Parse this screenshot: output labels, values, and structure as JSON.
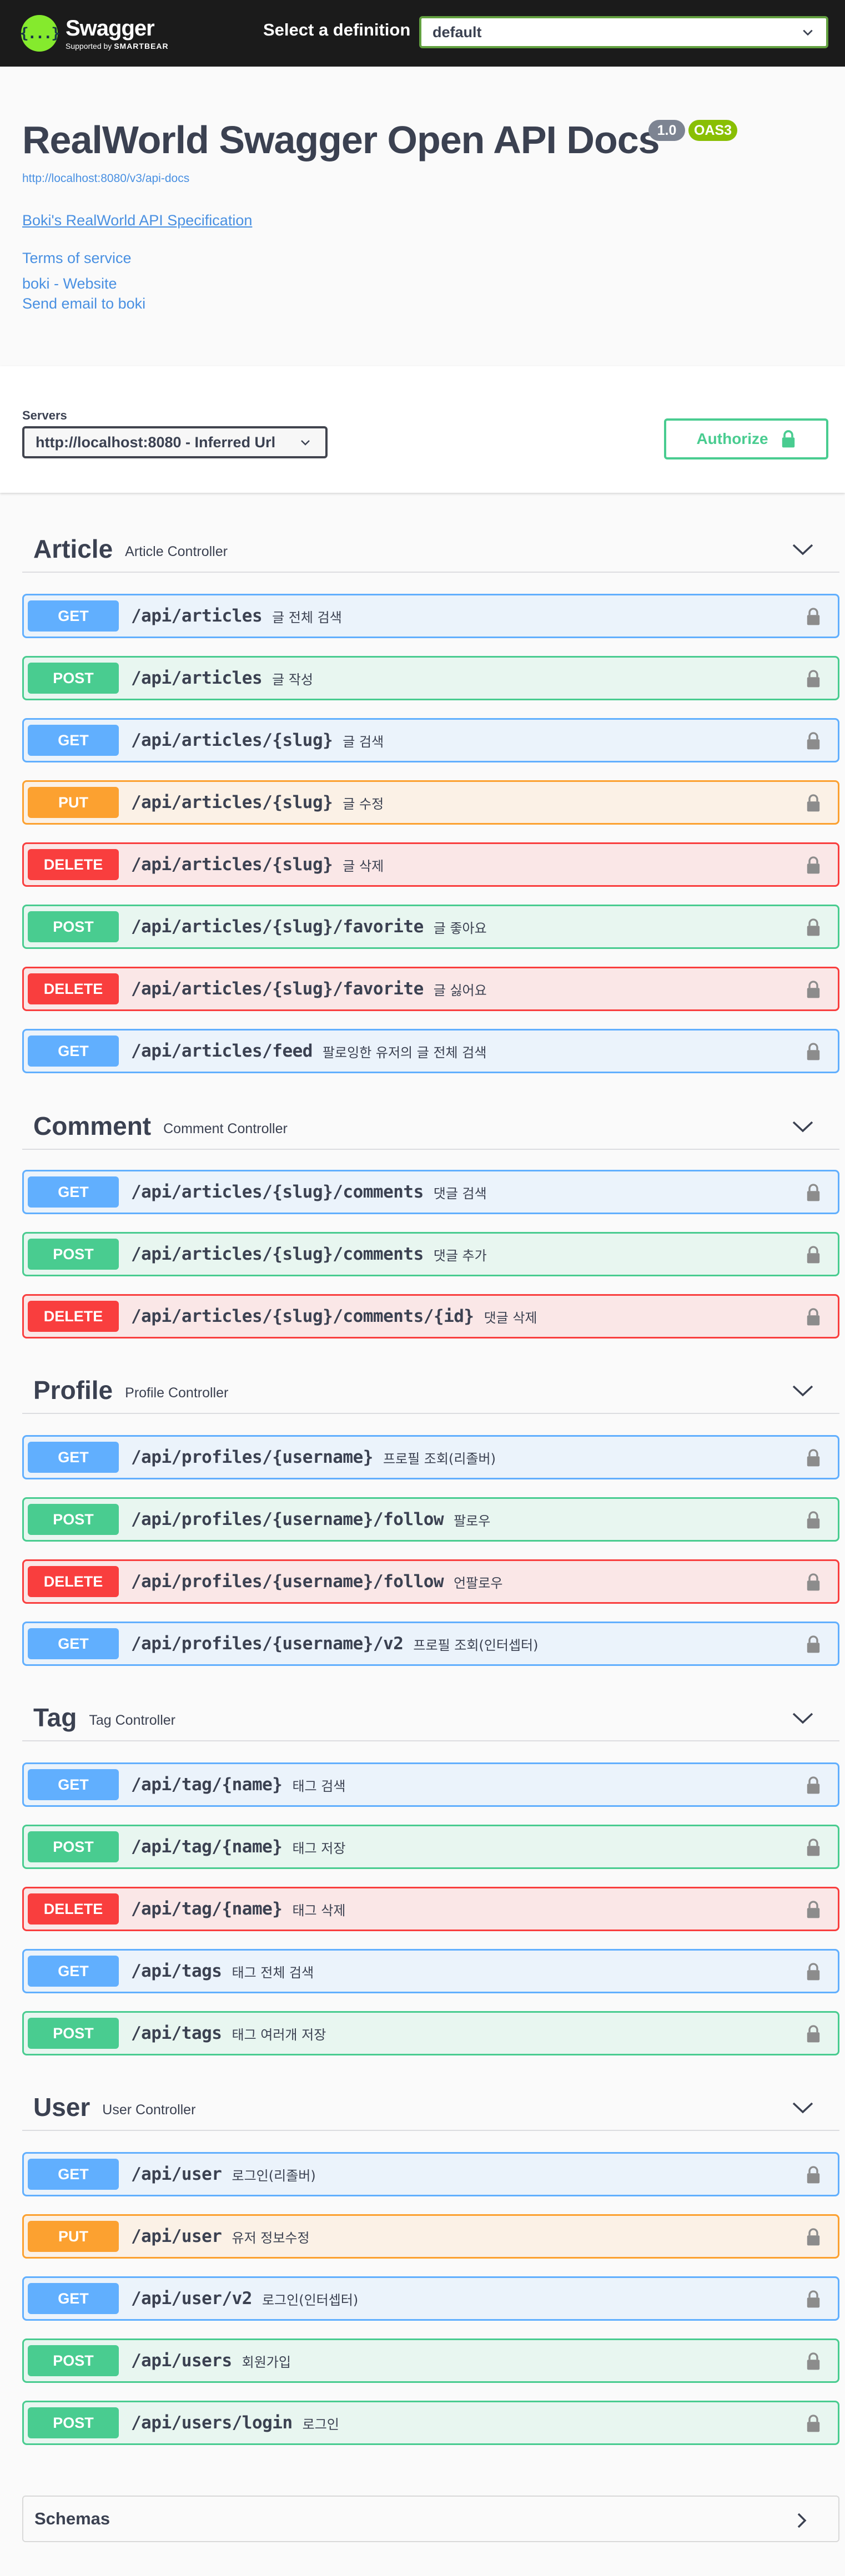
{
  "topbar": {
    "logo_name": "Swagger",
    "logo_supported": "Supported by",
    "logo_brand": "SMARTBEAR",
    "definition_label": "Select a definition",
    "definition_value": "default"
  },
  "info": {
    "title": "RealWorld Swagger Open API Docs",
    "version": "1.0",
    "oas": "OAS3",
    "spec_url": "http://localhost:8080/v3/api-docs",
    "description_link": "Boki's RealWorld API Specification",
    "terms": "Terms of service",
    "website": "boki - Website",
    "email": "Send email to boki"
  },
  "servers": {
    "label": "Servers",
    "selected": "http://localhost:8080 - Inferred Url",
    "authorize_label": "Authorize"
  },
  "tags": [
    {
      "name": "Article",
      "description": "Article Controller",
      "operations": [
        {
          "method": "GET",
          "path": "/api/articles",
          "summary": "글 전체 검색"
        },
        {
          "method": "POST",
          "path": "/api/articles",
          "summary": "글 작성"
        },
        {
          "method": "GET",
          "path": "/api/articles/{slug}",
          "summary": "글 검색"
        },
        {
          "method": "PUT",
          "path": "/api/articles/{slug}",
          "summary": "글 수정"
        },
        {
          "method": "DELETE",
          "path": "/api/articles/{slug}",
          "summary": "글 삭제"
        },
        {
          "method": "POST",
          "path": "/api/articles/{slug}/favorite",
          "summary": "글 좋아요"
        },
        {
          "method": "DELETE",
          "path": "/api/articles/{slug}/favorite",
          "summary": "글 싫어요"
        },
        {
          "method": "GET",
          "path": "/api/articles/feed",
          "summary": "팔로잉한 유저의 글 전체 검색"
        }
      ]
    },
    {
      "name": "Comment",
      "description": "Comment Controller",
      "operations": [
        {
          "method": "GET",
          "path": "/api/articles/{slug}/comments",
          "summary": "댓글 검색"
        },
        {
          "method": "POST",
          "path": "/api/articles/{slug}/comments",
          "summary": "댓글 추가"
        },
        {
          "method": "DELETE",
          "path": "/api/articles/{slug}/comments/{id}",
          "summary": "댓글 삭제"
        }
      ]
    },
    {
      "name": "Profile",
      "description": "Profile Controller",
      "operations": [
        {
          "method": "GET",
          "path": "/api/profiles/{username}",
          "summary": "프로필 조회(리졸버)"
        },
        {
          "method": "POST",
          "path": "/api/profiles/{username}/follow",
          "summary": "팔로우"
        },
        {
          "method": "DELETE",
          "path": "/api/profiles/{username}/follow",
          "summary": "언팔로우"
        },
        {
          "method": "GET",
          "path": "/api/profiles/{username}/v2",
          "summary": "프로필 조회(인터셉터)"
        }
      ]
    },
    {
      "name": "Tag",
      "description": "Tag Controller",
      "operations": [
        {
          "method": "GET",
          "path": "/api/tag/{name}",
          "summary": "태그 검색"
        },
        {
          "method": "POST",
          "path": "/api/tag/{name}",
          "summary": "태그 저장"
        },
        {
          "method": "DELETE",
          "path": "/api/tag/{name}",
          "summary": "태그 삭제"
        },
        {
          "method": "GET",
          "path": "/api/tags",
          "summary": "태그 전체 검색"
        },
        {
          "method": "POST",
          "path": "/api/tags",
          "summary": "태그 여러개 저장"
        }
      ]
    },
    {
      "name": "User",
      "description": "User Controller",
      "operations": [
        {
          "method": "GET",
          "path": "/api/user",
          "summary": "로그인(리졸버)"
        },
        {
          "method": "PUT",
          "path": "/api/user",
          "summary": "유저 정보수정"
        },
        {
          "method": "GET",
          "path": "/api/user/v2",
          "summary": "로그인(인터셉터)"
        },
        {
          "method": "POST",
          "path": "/api/users",
          "summary": "회원가입"
        },
        {
          "method": "POST",
          "path": "/api/users/login",
          "summary": "로그인"
        }
      ]
    }
  ],
  "schemas": {
    "label": "Schemas"
  }
}
